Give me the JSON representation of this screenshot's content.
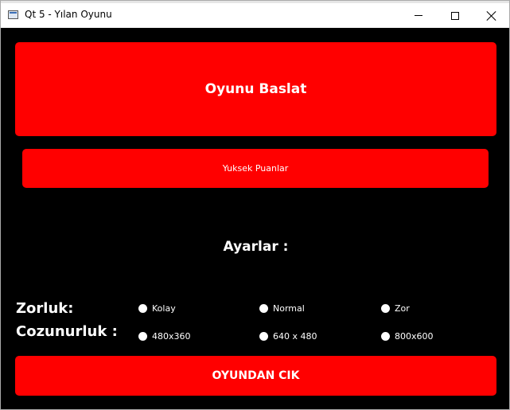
{
  "window": {
    "title": "Qt 5 - Yılan Oyunu"
  },
  "buttons": {
    "start": "Oyunu Baslat",
    "high_scores": "Yuksek Puanlar",
    "quit": "OYUNDAN CIK"
  },
  "settings": {
    "title": "Ayarlar :",
    "difficulty_label": "Zorluk:",
    "resolution_label": "Cozunurluk :",
    "difficulty_options": [
      "Kolay",
      "Normal",
      "Zor"
    ],
    "resolution_options": [
      "480x360",
      "640 x 480",
      "800x600"
    ]
  },
  "colors": {
    "background": "#000000",
    "button": "#ff0000",
    "text": "#ffffff"
  }
}
